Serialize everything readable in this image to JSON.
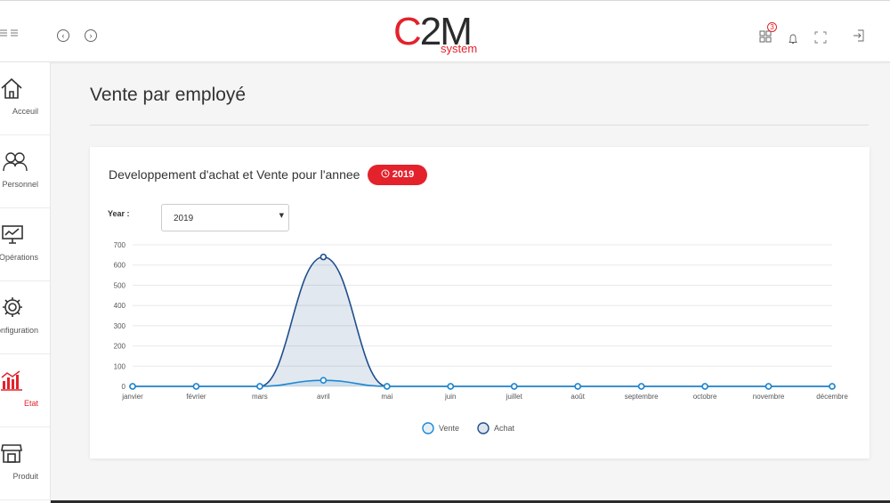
{
  "topbar": {
    "menu_icon": "list-icon",
    "back_icon": "chevron-left-circle-icon",
    "forward_icon": "chevron-right-circle-icon",
    "logo_main_c": "C",
    "logo_main_rest": "2M",
    "logo_sub": "system",
    "apps_icon": "grid-icon",
    "apps_badge": "3",
    "bell_icon": "bell-icon",
    "fullscreen_icon": "expand-icon",
    "logout_icon": "sign-out-icon"
  },
  "sidebar": {
    "items": [
      {
        "label": "Acceuil",
        "icon": "home-icon"
      },
      {
        "label": "Personnel",
        "icon": "users-icon"
      },
      {
        "label": "Opérations",
        "icon": "monitor-icon"
      },
      {
        "label": "Configuration",
        "icon": "gear-icon"
      },
      {
        "label": "Etat",
        "icon": "bar-chart-icon",
        "active": true
      },
      {
        "label": "Produit",
        "icon": "store-icon"
      }
    ],
    "active_color": "#e3222b"
  },
  "page": {
    "title": "Vente par employé"
  },
  "card": {
    "title": "Developpement d'achat et Vente pour l'annee",
    "year_badge": "2019",
    "badge_icon": "clock-icon",
    "year_label": "Year :",
    "year_value": "2019"
  },
  "colors": {
    "brand": "#e3222b",
    "vente": "#1e88d2",
    "achat": "#1f4e8c"
  },
  "chart_data": {
    "type": "line",
    "categories": [
      "janvier",
      "février",
      "mars",
      "avril",
      "mai",
      "juin",
      "juillet",
      "août",
      "septembre",
      "octobre",
      "novembre",
      "décembre"
    ],
    "series": [
      {
        "name": "Vente",
        "values": [
          0,
          0,
          0,
          30,
          0,
          0,
          0,
          0,
          0,
          0,
          0,
          0
        ]
      },
      {
        "name": "Achat",
        "values": [
          0,
          0,
          0,
          640,
          0,
          0,
          0,
          0,
          0,
          0,
          0,
          0
        ]
      }
    ],
    "y_ticks": [
      0,
      100,
      200,
      300,
      400,
      500,
      600,
      700
    ],
    "ylim": [
      0,
      700
    ],
    "grid": true,
    "legend": "bottom-center"
  }
}
